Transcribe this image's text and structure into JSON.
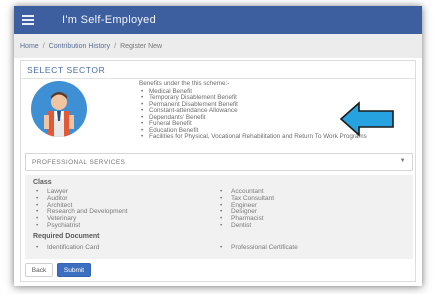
{
  "app": {
    "title": "I'm Self-Employed"
  },
  "breadcrumb": [
    "Home",
    "Contribution History",
    "Register New"
  ],
  "section": {
    "title": "SELECT SECTOR"
  },
  "benefits": {
    "intro": "Benefits under the this scheme:-",
    "items": [
      "Medical Benefit",
      "Temporary Disablement Benefit",
      "Permanent Disablement Benefit",
      "Constant-attendance Allowance",
      "Dependants' Benefit",
      "Funeral Benefit",
      "Education Benefit",
      "Facilities for Physical, Vocational Rehabilitation and Return To Work Programs"
    ]
  },
  "sector_select": {
    "value": "PROFESSIONAL SERVICES"
  },
  "class_section": {
    "label": "Class",
    "left": [
      "Lawyer",
      "Auditor",
      "Architect",
      "Research and Development",
      "Veterinary",
      "Psychiatrist"
    ],
    "right": [
      "Accountant",
      "Tax Consultant",
      "Engineer",
      "Designer",
      "Pharmacist",
      "Dentist"
    ]
  },
  "required_document": {
    "label": "Required Document",
    "left": [
      "Identification Card"
    ],
    "right": [
      "Professional Certificate"
    ]
  },
  "buttons": {
    "back": "Back",
    "submit": "Submit"
  },
  "colors": {
    "header": "#3d5f9f",
    "accent": "#4a6ca4",
    "arrow": "#27a2e0",
    "submit": "#3d6fc0"
  },
  "icons": {
    "menu": "hamburger-icon",
    "avatar": "worker-avatar-icon",
    "pointer": "arrow-left-icon",
    "dropdown": "caret-down-icon"
  }
}
